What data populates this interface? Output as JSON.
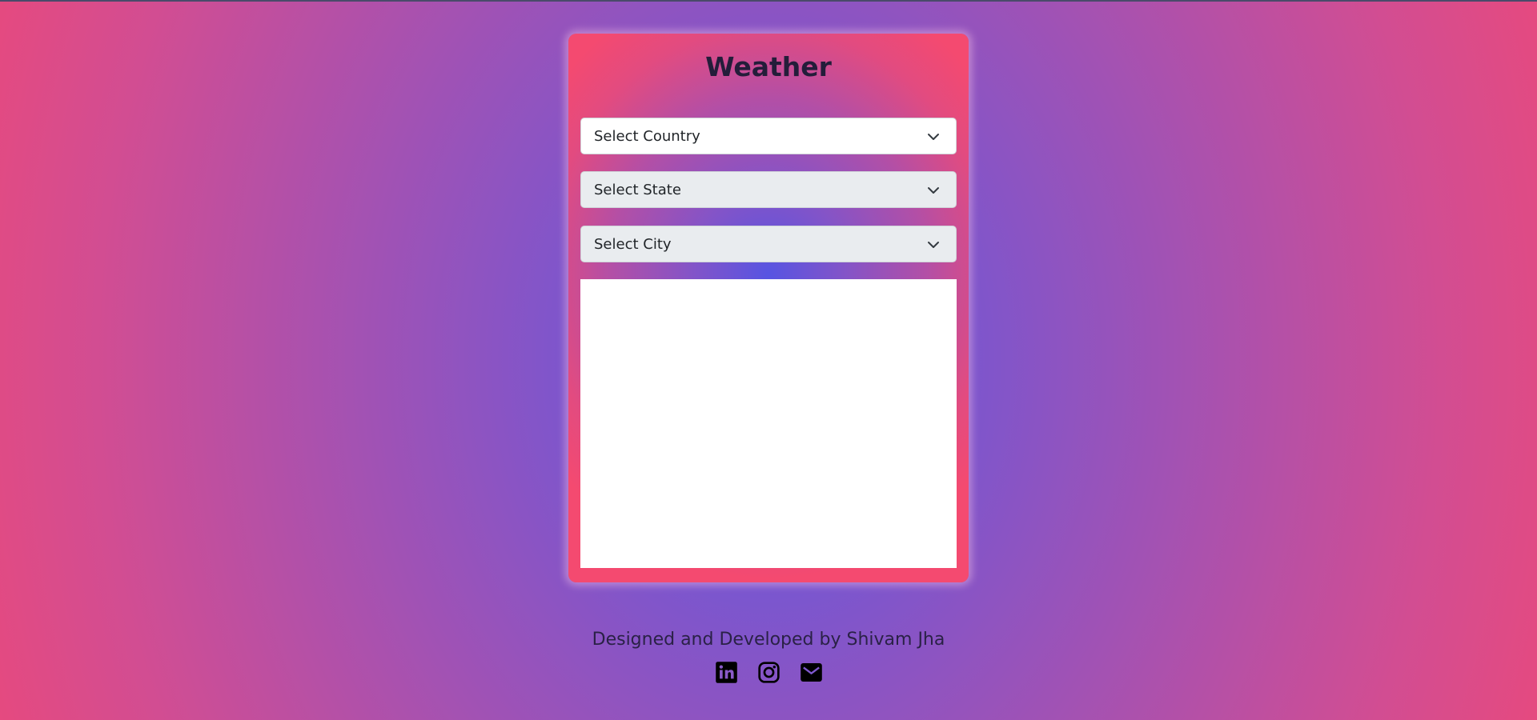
{
  "app": {
    "title": "Weather"
  },
  "selects": {
    "country": {
      "label": "Select Country",
      "state": "enabled"
    },
    "state": {
      "label": "Select State",
      "state": "disabled"
    },
    "city": {
      "label": "Select City",
      "state": "disabled"
    }
  },
  "footer": {
    "credit": "Designed and Developed by Shivam Jha",
    "socials": [
      {
        "icon": "linkedin-icon"
      },
      {
        "icon": "instagram-icon"
      },
      {
        "icon": "envelope-icon"
      }
    ]
  },
  "colors": {
    "gradient_center": "#5a5ae0",
    "gradient_edge": "#f7476e",
    "title_text": "#241d3a"
  }
}
